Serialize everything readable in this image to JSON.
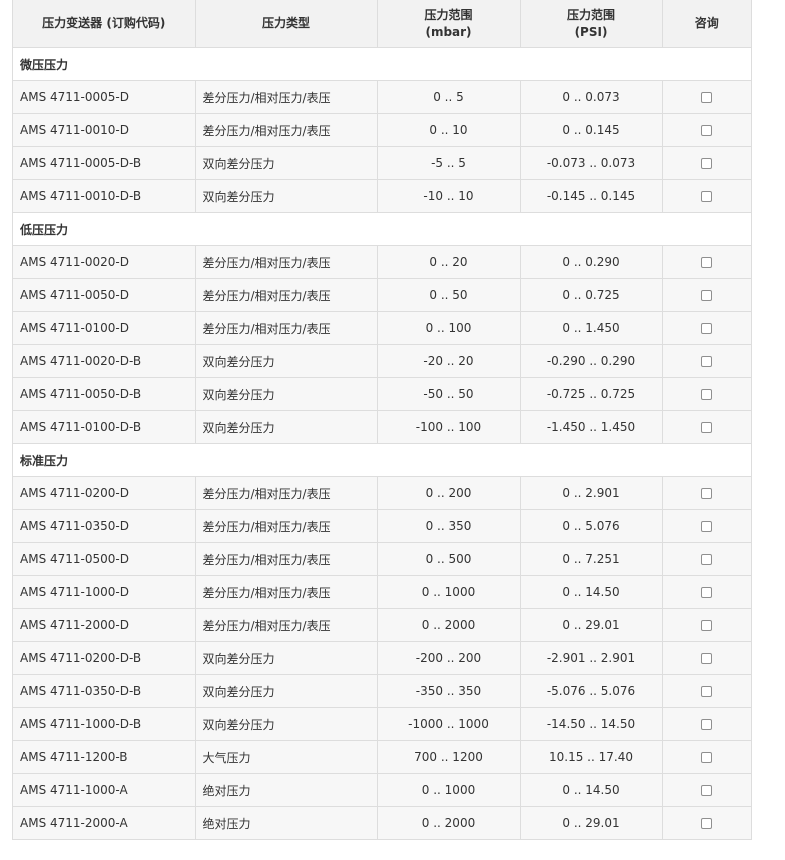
{
  "header": {
    "col_model": "压力变送器 (订购代码)",
    "col_type": "压力类型",
    "col_mbar_top": "压力范围",
    "col_mbar_unit": "(mbar)",
    "col_psi_top": "压力范围",
    "col_psi_unit": "(PSI)",
    "col_consult": "咨询"
  },
  "groups": [
    {
      "title": "微压压力",
      "rows": [
        {
          "model": "AMS 4711-0005-D",
          "type": "差分压力/相对压力/表压",
          "mbar": "0 .. 5",
          "psi": "0 .. 0.073"
        },
        {
          "model": "AMS 4711-0010-D",
          "type": "差分压力/相对压力/表压",
          "mbar": "0 .. 10",
          "psi": "0 .. 0.145"
        },
        {
          "model": "AMS 4711-0005-D-B",
          "type": "双向差分压力",
          "mbar": "-5 .. 5",
          "psi": "-0.073 .. 0.073"
        },
        {
          "model": "AMS 4711-0010-D-B",
          "type": "双向差分压力",
          "mbar": "-10 .. 10",
          "psi": "-0.145 .. 0.145"
        }
      ]
    },
    {
      "title": "低压压力",
      "rows": [
        {
          "model": "AMS 4711-0020-D",
          "type": "差分压力/相对压力/表压",
          "mbar": "0 .. 20",
          "psi": "0 .. 0.290"
        },
        {
          "model": "AMS 4711-0050-D",
          "type": "差分压力/相对压力/表压",
          "mbar": "0 .. 50",
          "psi": "0 .. 0.725"
        },
        {
          "model": "AMS 4711-0100-D",
          "type": "差分压力/相对压力/表压",
          "mbar": "0 .. 100",
          "psi": "0 .. 1.450"
        },
        {
          "model": "AMS 4711-0020-D-B",
          "type": "双向差分压力",
          "mbar": "-20 .. 20",
          "psi": "-0.290 .. 0.290"
        },
        {
          "model": "AMS 4711-0050-D-B",
          "type": "双向差分压力",
          "mbar": "-50 .. 50",
          "psi": "-0.725 .. 0.725"
        },
        {
          "model": "AMS 4711-0100-D-B",
          "type": "双向差分压力",
          "mbar": "-100 .. 100",
          "psi": "-1.450 .. 1.450"
        }
      ]
    },
    {
      "title": "标准压力",
      "rows": [
        {
          "model": "AMS 4711-0200-D",
          "type": "差分压力/相对压力/表压",
          "mbar": "0 .. 200",
          "psi": "0 .. 2.901"
        },
        {
          "model": "AMS 4711-0350-D",
          "type": "差分压力/相对压力/表压",
          "mbar": "0 .. 350",
          "psi": "0 .. 5.076"
        },
        {
          "model": "AMS 4711-0500-D",
          "type": "差分压力/相对压力/表压",
          "mbar": "0 .. 500",
          "psi": "0 .. 7.251"
        },
        {
          "model": "AMS 4711-1000-D",
          "type": "差分压力/相对压力/表压",
          "mbar": "0 .. 1000",
          "psi": "0 .. 14.50"
        },
        {
          "model": "AMS 4711-2000-D",
          "type": "差分压力/相对压力/表压",
          "mbar": "0 .. 2000",
          "psi": "0 .. 29.01"
        },
        {
          "model": "AMS 4711-0200-D-B",
          "type": "双向差分压力",
          "mbar": "-200 .. 200",
          "psi": "-2.901 .. 2.901"
        },
        {
          "model": "AMS 4711-0350-D-B",
          "type": "双向差分压力",
          "mbar": "-350 .. 350",
          "psi": "-5.076 .. 5.076"
        },
        {
          "model": "AMS 4711-1000-D-B",
          "type": "双向差分压力",
          "mbar": "-1000 .. 1000",
          "psi": "-14.50 .. 14.50"
        },
        {
          "model": "AMS 4711-1200-B",
          "type": "大气压力",
          "mbar": "700 .. 1200",
          "psi": "10.15 .. 17.40"
        },
        {
          "model": "AMS 4711-1000-A",
          "type": "绝对压力",
          "mbar": "0 .. 1000",
          "psi": "0 .. 14.50"
        },
        {
          "model": "AMS 4711-2000-A",
          "type": "绝对压力",
          "mbar": "0 .. 2000",
          "psi": "0 .. 29.01"
        }
      ]
    }
  ]
}
